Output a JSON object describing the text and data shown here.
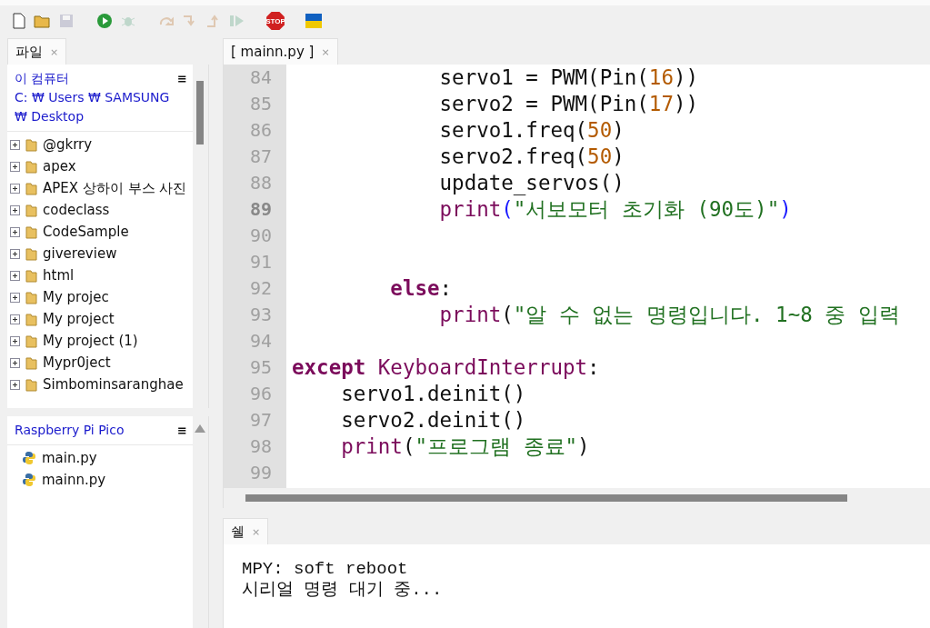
{
  "toolbar": {
    "buttons": [
      {
        "kind": "new",
        "disabled": false
      },
      {
        "kind": "open",
        "disabled": false
      },
      {
        "kind": "save",
        "disabled": true
      },
      {
        "kind": "gap"
      },
      {
        "kind": "run",
        "disabled": false
      },
      {
        "kind": "debug",
        "disabled": true
      },
      {
        "kind": "gap"
      },
      {
        "kind": "step_over",
        "disabled": true
      },
      {
        "kind": "step_into",
        "disabled": true
      },
      {
        "kind": "step_out",
        "disabled": true
      },
      {
        "kind": "resume",
        "disabled": true
      },
      {
        "kind": "gap"
      },
      {
        "kind": "stop",
        "disabled": false,
        "label": "STOP"
      },
      {
        "kind": "gap"
      },
      {
        "kind": "flag",
        "disabled": false
      }
    ]
  },
  "files_panel": {
    "tab": {
      "label": "파일",
      "close": "×",
      "selected": true
    },
    "computer": {
      "title": "이 컴퓨터",
      "path": "C: ₩ Users ₩ SAMSUNG ₩ Desktop",
      "menu": "≡",
      "items": [
        {
          "name": "@gkrry",
          "expanded": false
        },
        {
          "name": "apex",
          "expanded": false
        },
        {
          "name": "APEX 상하이 부스 사진",
          "expanded": false
        },
        {
          "name": "codeclass",
          "expanded": false
        },
        {
          "name": "CodeSample",
          "expanded": false
        },
        {
          "name": "givereview",
          "expanded": false
        },
        {
          "name": "html",
          "expanded": false
        },
        {
          "name": "My projec",
          "expanded": false
        },
        {
          "name": "My project",
          "expanded": false
        },
        {
          "name": "My project (1)",
          "expanded": false
        },
        {
          "name": "Mypr0ject",
          "expanded": false
        },
        {
          "name": "Simbominsaranghae",
          "expanded": false
        }
      ]
    },
    "device": {
      "title": "Raspberry Pi Pico",
      "menu": "≡",
      "files": [
        {
          "name": "main.py"
        },
        {
          "name": "mainn.py"
        }
      ]
    }
  },
  "editor": {
    "tabs": [
      {
        "label": "[ mainn.py ]",
        "close": "×",
        "selected": true
      }
    ],
    "lines": [
      {
        "number": "84",
        "current": false,
        "tokens": [
          {
            "text": "            servo1 = PWM(Pin(",
            "kind": "plain"
          },
          {
            "text": "16",
            "kind": "num"
          },
          {
            "text": "))",
            "kind": "plain"
          }
        ]
      },
      {
        "number": "85",
        "current": false,
        "tokens": [
          {
            "text": "            servo2 = PWM(Pin(",
            "kind": "plain"
          },
          {
            "text": "17",
            "kind": "num"
          },
          {
            "text": "))",
            "kind": "plain"
          }
        ]
      },
      {
        "number": "86",
        "current": false,
        "tokens": [
          {
            "text": "            servo1.freq(",
            "kind": "plain"
          },
          {
            "text": "50",
            "kind": "num"
          },
          {
            "text": ")",
            "kind": "plain"
          }
        ]
      },
      {
        "number": "87",
        "current": false,
        "tokens": [
          {
            "text": "            servo2.freq(",
            "kind": "plain"
          },
          {
            "text": "50",
            "kind": "num"
          },
          {
            "text": ")",
            "kind": "plain"
          }
        ]
      },
      {
        "number": "88",
        "current": false,
        "tokens": [
          {
            "text": "            update_servos()",
            "kind": "plain"
          }
        ]
      },
      {
        "number": "89",
        "current": true,
        "tokens": [
          {
            "text": "            print",
            "kind": "builtin"
          },
          {
            "text": "(",
            "kind": "bracket"
          },
          {
            "text": "\"서보모터 초기화 (90도)\"",
            "kind": "str"
          },
          {
            "text": ")",
            "kind": "bracket"
          }
        ]
      },
      {
        "number": "90",
        "current": false
      },
      {
        "number": "91",
        "current": false
      },
      {
        "number": "92",
        "current": false,
        "tokens": [
          {
            "text": "        else",
            "kind": "kw"
          },
          {
            "text": ":",
            "kind": "plain"
          }
        ]
      },
      {
        "number": "93",
        "current": false,
        "tokens": [
          {
            "text": "            print",
            "kind": "builtin"
          },
          {
            "text": "(",
            "kind": "plain"
          },
          {
            "text": "\"알 수 없는 명령입니다. 1~8 중 입력",
            "kind": "str"
          }
        ]
      },
      {
        "number": "94",
        "current": false
      },
      {
        "number": "95",
        "current": false,
        "tokens": [
          {
            "text": "except",
            "kind": "kw"
          },
          {
            "text": " KeyboardInterrupt",
            "kind": "builtin"
          },
          {
            "text": ":",
            "kind": "plain"
          }
        ]
      },
      {
        "number": "96",
        "current": false,
        "tokens": [
          {
            "text": "    servo1.deinit()",
            "kind": "plain"
          }
        ]
      },
      {
        "number": "97",
        "current": false,
        "tokens": [
          {
            "text": "    servo2.deinit()",
            "kind": "plain"
          }
        ]
      },
      {
        "number": "98",
        "current": false,
        "tokens": [
          {
            "text": "    print",
            "kind": "builtin"
          },
          {
            "text": "(",
            "kind": "plain"
          },
          {
            "text": "\"프로그램 종료\"",
            "kind": "str"
          },
          {
            "text": ")",
            "kind": "plain"
          }
        ]
      },
      {
        "number": "99",
        "current": false
      }
    ]
  },
  "shell": {
    "tab": {
      "label": "쉘",
      "close": "×",
      "selected": true
    },
    "lines": [
      "MPY: soft reboot",
      "시리얼 명령 대기 중..."
    ]
  }
}
